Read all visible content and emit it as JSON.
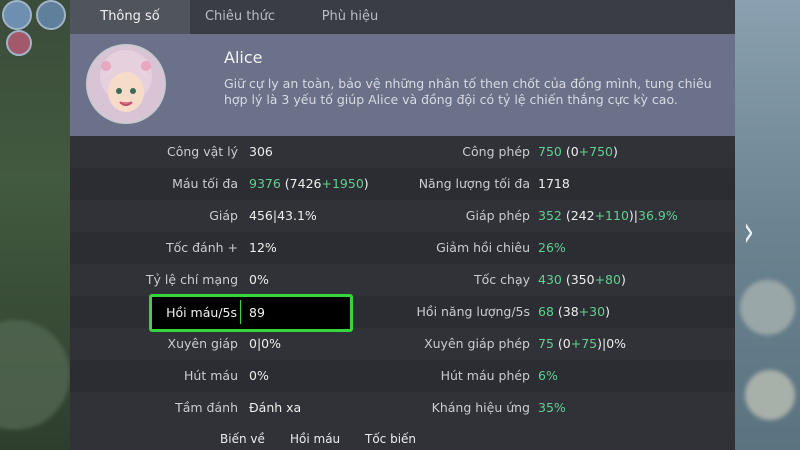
{
  "tabs": [
    {
      "label": "Thông số",
      "active": true
    },
    {
      "label": "Chiêu thức",
      "active": false
    },
    {
      "label": "Phù hiệu",
      "active": false
    }
  ],
  "hero": {
    "name": "Alice",
    "description": "Giữ cự ly an toàn, bảo vệ những nhân tố then chốt của đồng mình, tung chiêu hợp lý là 3 yếu tố giúp Alice và đồng đội có tỷ lệ chiến thắng cực kỳ cao."
  },
  "stats_left": [
    {
      "label": "Công vật lý",
      "value": "306"
    },
    {
      "label": "Máu tối đa",
      "v1": "9376",
      "v2": " (7426",
      "v3": "+1950",
      "v4": ")"
    },
    {
      "label": "Giáp",
      "value": "456|43.1%"
    },
    {
      "label": "Tốc đánh +",
      "value": "12%"
    },
    {
      "label": "Tỷ lệ chí mạng",
      "value": "0%"
    },
    {
      "label": "Hồi máu/5s",
      "value": "89"
    },
    {
      "label": "Xuyên giáp",
      "value": "0|0%"
    },
    {
      "label": "Hút máu",
      "value": "0%"
    },
    {
      "label": "Tầm đánh",
      "value": "Đánh xa"
    }
  ],
  "stats_right": [
    {
      "label": "Công phép",
      "v1": "750",
      "v2": " (0",
      "v3": "+750",
      "v4": ")"
    },
    {
      "label": "Năng lượng tối đa",
      "value": "1718"
    },
    {
      "label": "Giáp phép",
      "v1": "352",
      "v2": " (242",
      "v3": "+110",
      "v4": ")|",
      "v5": "36.9%"
    },
    {
      "label": "Giảm hồi chiêu",
      "value": "26%"
    },
    {
      "label": "Tốc chạy",
      "v1": "430",
      "v2": " (350",
      "v3": "+80",
      "v4": ")"
    },
    {
      "label": "Hồi năng lượng/5s",
      "v1": "68",
      "v2": " (38",
      "v3": "+30",
      "v4": ")"
    },
    {
      "label": "Xuyên giáp phép",
      "v1": "75",
      "v2": " (0",
      "v3": "+75",
      "v4": ")|0%"
    },
    {
      "label": "Hút máu phép",
      "value": "6%"
    },
    {
      "label": "Kháng hiệu ứng",
      "value": "35%"
    }
  ],
  "bottom_skills": [
    "Biến về",
    "Hồi máu",
    "Tốc biến"
  ],
  "colors": {
    "accent_green": "#5fd08e",
    "highlight_border": "#33d63b",
    "panel": "#303238",
    "hero_band": "#6a7189"
  }
}
